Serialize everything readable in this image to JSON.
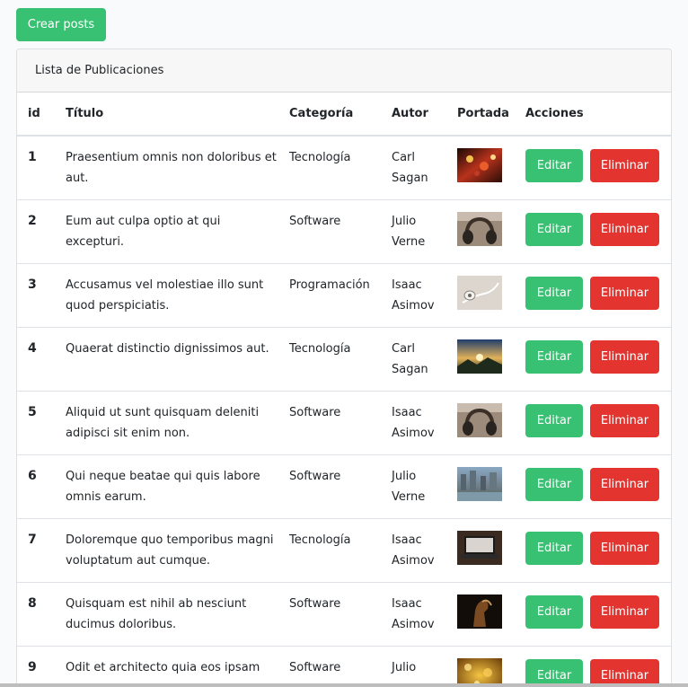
{
  "toolbar": {
    "create_label": "Crear posts"
  },
  "card": {
    "header": "Lista de Publicaciones"
  },
  "table": {
    "columns": [
      "id",
      "Título",
      "Categoría",
      "Autor",
      "Portada",
      "Acciones"
    ],
    "edit_label": "Editar",
    "delete_label": "Eliminar",
    "rows": [
      {
        "id": "1",
        "title": "Praesentium omnis non doloribus et aut.",
        "category": "Tecnología",
        "author": "Carl Sagan",
        "cover": "colorful-abstract-image"
      },
      {
        "id": "2",
        "title": "Eum aut culpa optio at qui excepturi.",
        "category": "Software",
        "author": "Julio Verne",
        "cover": "headphones-image"
      },
      {
        "id": "3",
        "title": "Accusamus vel molestiae illo sunt quod perspiciatis.",
        "category": "Programación",
        "author": "Isaac Asimov",
        "cover": "earphones-image"
      },
      {
        "id": "4",
        "title": "Quaerat distinctio dignissimos aut.",
        "category": "Tecnología",
        "author": "Carl Sagan",
        "cover": "sunset-landscape-image"
      },
      {
        "id": "5",
        "title": "Aliquid ut sunt quisquam deleniti adipisci sit enim non.",
        "category": "Software",
        "author": "Isaac Asimov",
        "cover": "headphones-image"
      },
      {
        "id": "6",
        "title": "Qui neque beatae qui quis labore omnis earum.",
        "category": "Software",
        "author": "Julio Verne",
        "cover": "city-river-image"
      },
      {
        "id": "7",
        "title": "Doloremque quo temporibus magni voluptatum aut cumque.",
        "category": "Tecnología",
        "author": "Isaac Asimov",
        "cover": "laptop-image"
      },
      {
        "id": "8",
        "title": "Quisquam est nihil ab nesciunt ducimus doloribus.",
        "category": "Software",
        "author": "Isaac Asimov",
        "cover": "horse-image"
      },
      {
        "id": "9",
        "title": "Odit et architecto quia eos ipsam",
        "category": "Software",
        "author": "Julio",
        "cover": "golden-bokeh-image"
      }
    ]
  },
  "colors": {
    "success": "#38c172",
    "danger": "#e3342f",
    "header_bg": "#f7f7f7",
    "page_bg": "#f8fafc"
  }
}
